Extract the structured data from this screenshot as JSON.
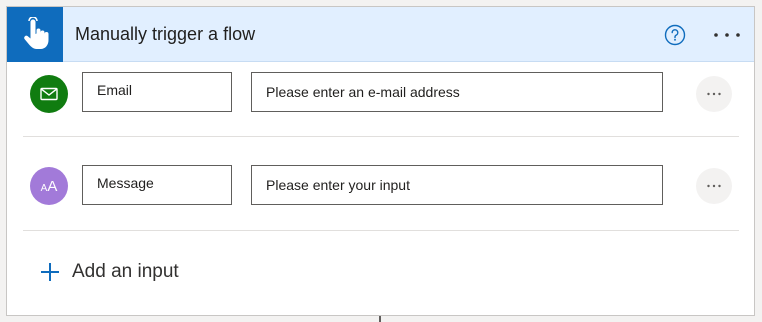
{
  "header": {
    "title": "Manually trigger a flow",
    "trigger_icon": "touch-hand-icon",
    "help_icon": "help-circle-icon",
    "more_icon": "more-ellipsis-icon"
  },
  "inputs": [
    {
      "type_icon": "email-envelope-icon",
      "name": "Email",
      "placeholder": "Please enter an e-mail address",
      "avatar_color": "#107c10"
    },
    {
      "type_icon": "text-aa-icon",
      "name": "Message",
      "placeholder": "Please enter your input",
      "avatar_color": "#a27ad9"
    }
  ],
  "add_input": {
    "label": "Add an input",
    "icon": "plus-icon"
  },
  "colors": {
    "header_bg": "#e1efff",
    "trigger_icon_bg": "#0f6cbd",
    "accent": "#0f6cbd"
  }
}
